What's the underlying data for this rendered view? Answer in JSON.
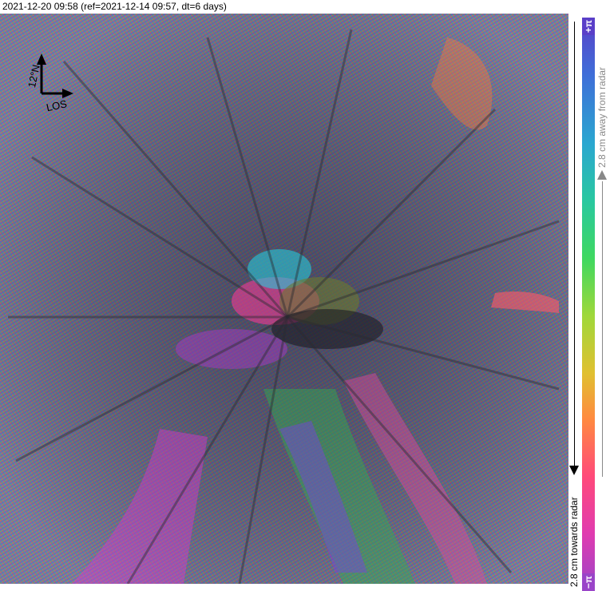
{
  "header": {
    "title": "2021-12-20 09:58 (ref=2021-12-14 09:57, dt=6 days)"
  },
  "compass": {
    "north_label": "12°N",
    "los_label": "LOS"
  },
  "colorbar": {
    "top_symbol": "+π",
    "bottom_symbol": "−π",
    "away_label": "2.8 cm away from radar",
    "towards_label": "2.8 cm towards radar",
    "away_color": "#888888",
    "towards_color": "#000000"
  }
}
